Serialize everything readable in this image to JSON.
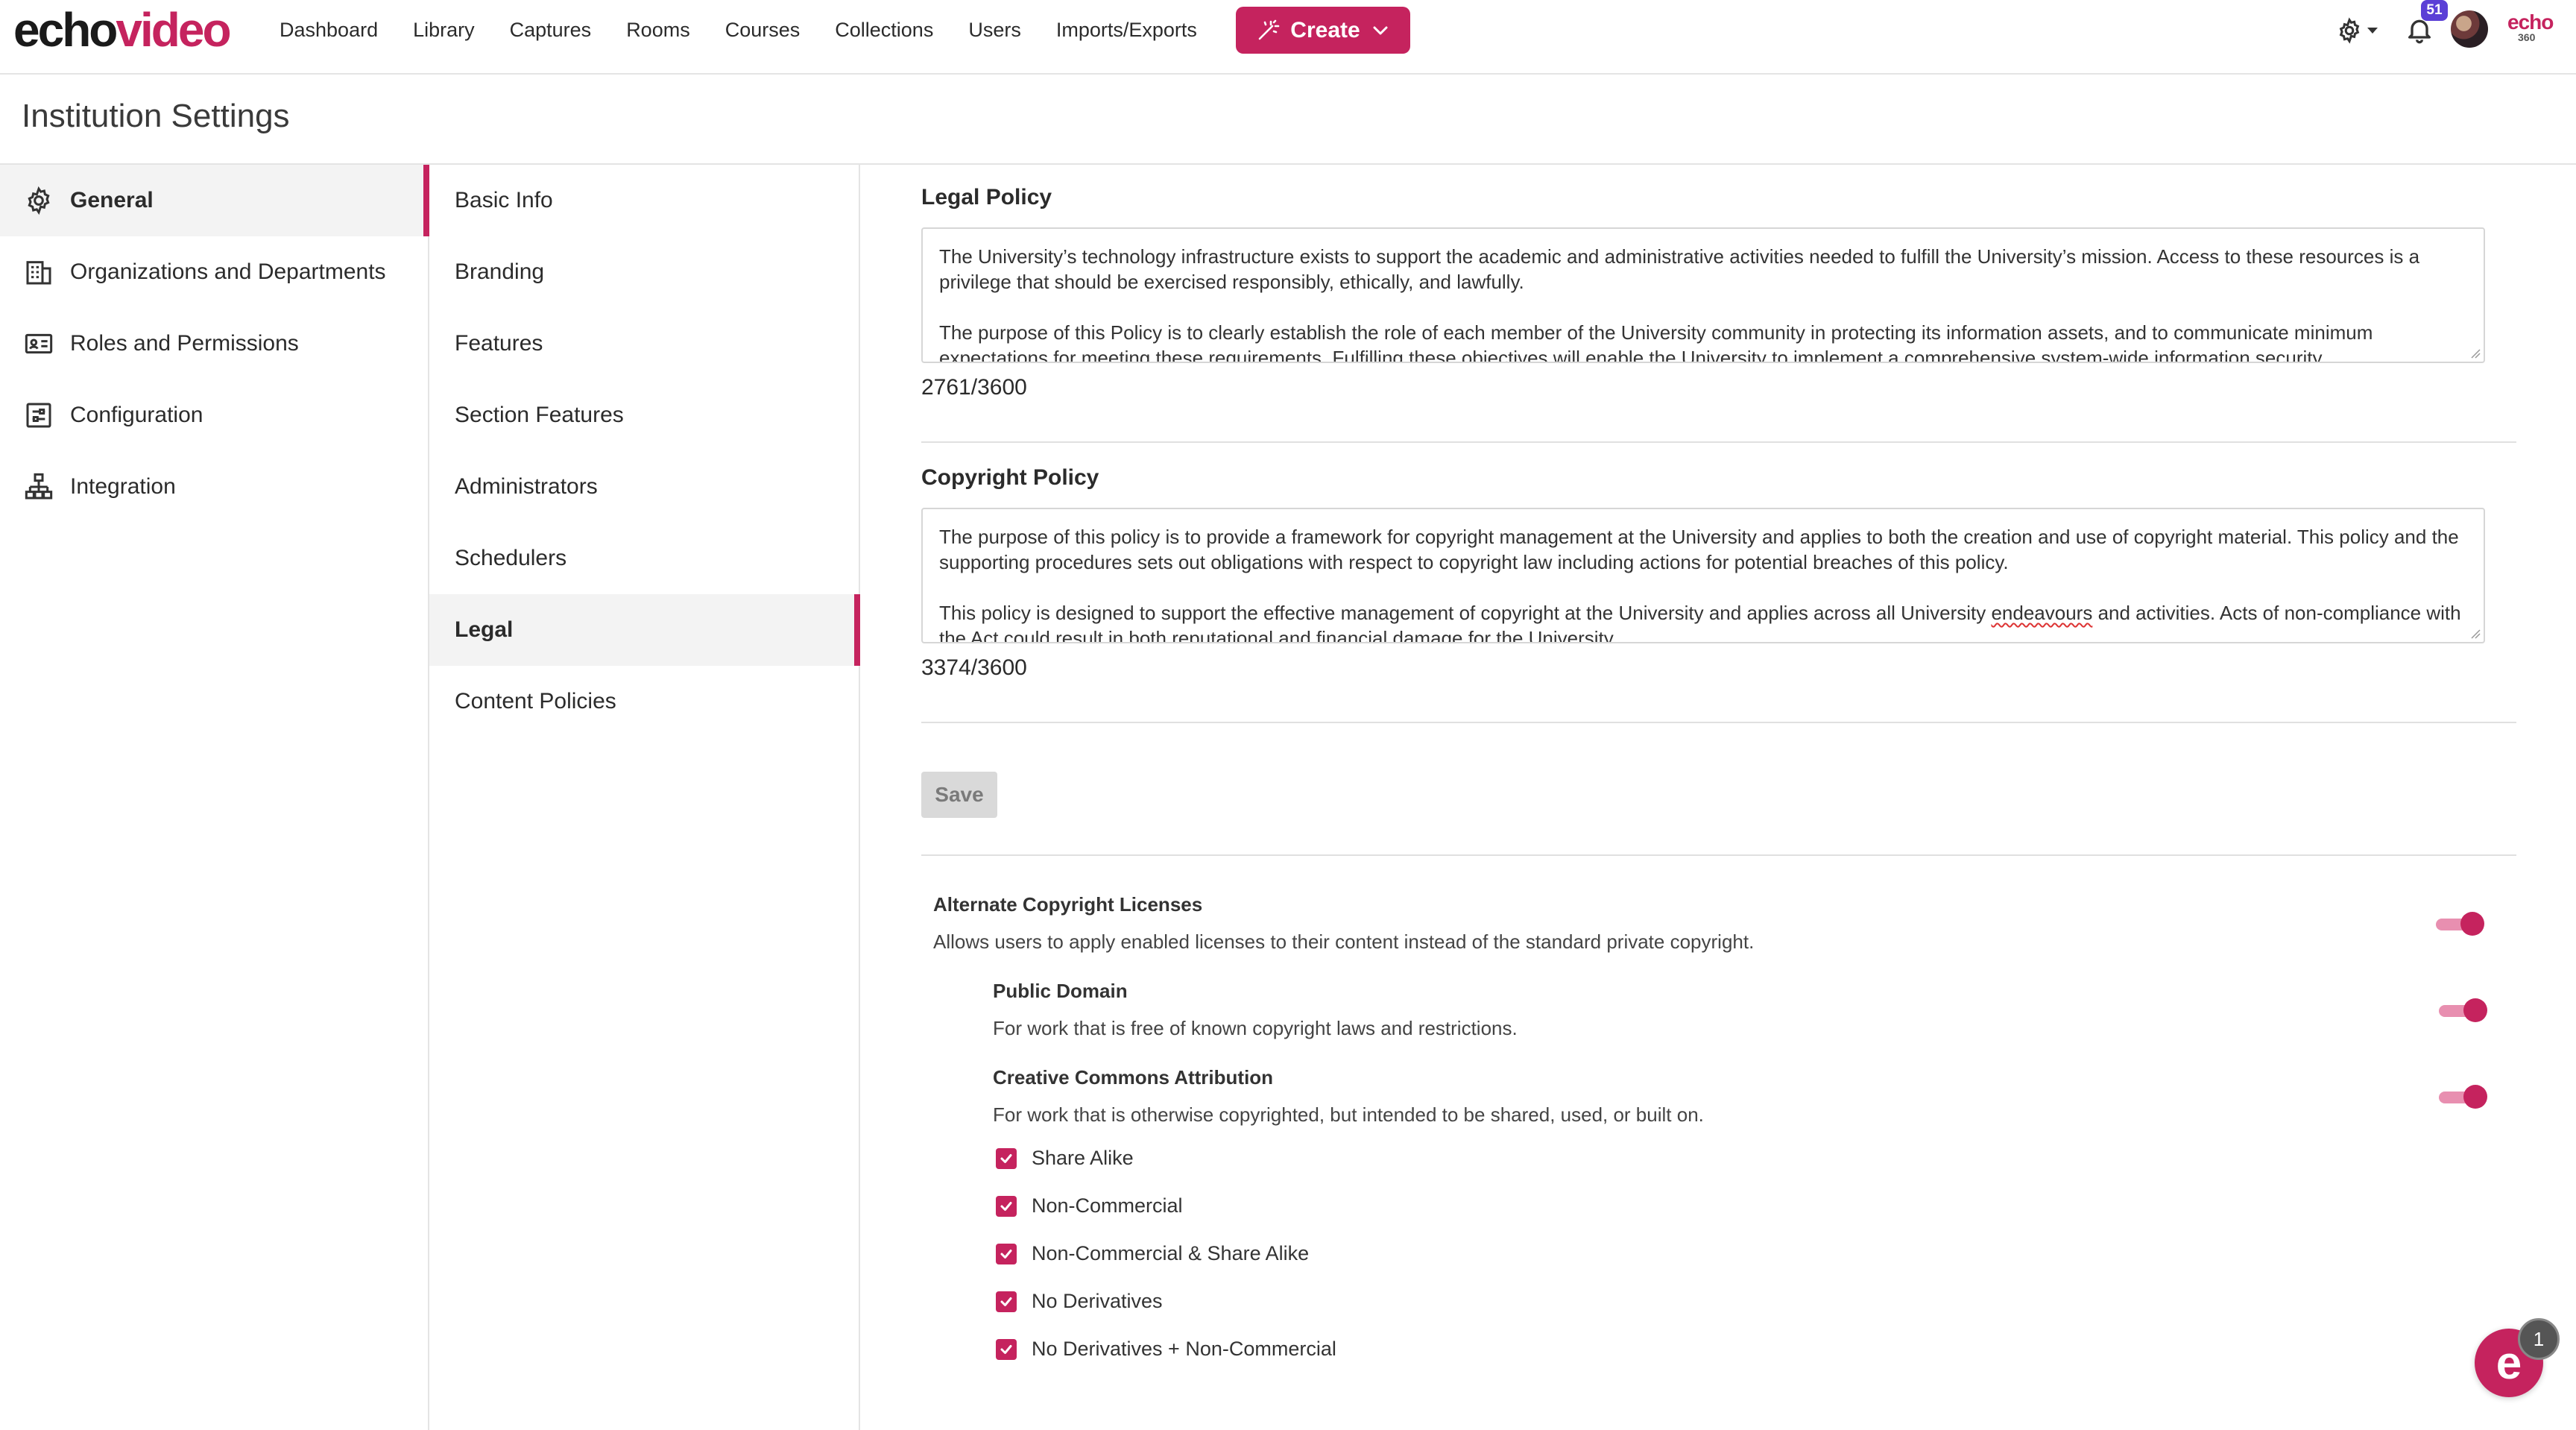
{
  "app": {
    "logo_part1": "echo",
    "logo_part2": "video",
    "nav": [
      "Dashboard",
      "Library",
      "Captures",
      "Rooms",
      "Courses",
      "Collections",
      "Users",
      "Imports/Exports"
    ],
    "create_label": "Create",
    "notification_count": "51",
    "brand_mark_top": "echo",
    "brand_mark_bottom": "360"
  },
  "page_title": "Institution Settings",
  "sidebar": {
    "items": [
      {
        "label": "General",
        "icon": "gear-icon",
        "active": true
      },
      {
        "label": "Organizations and Departments",
        "icon": "building-icon",
        "active": false
      },
      {
        "label": "Roles and Permissions",
        "icon": "id-card-icon",
        "active": false
      },
      {
        "label": "Configuration",
        "icon": "sliders-icon",
        "active": false
      },
      {
        "label": "Integration",
        "icon": "network-icon",
        "active": false
      }
    ]
  },
  "subnav": {
    "items": [
      {
        "label": "Basic Info",
        "active": false
      },
      {
        "label": "Branding",
        "active": false
      },
      {
        "label": "Features",
        "active": false
      },
      {
        "label": "Section Features",
        "active": false
      },
      {
        "label": "Administrators",
        "active": false
      },
      {
        "label": "Schedulers",
        "active": false
      },
      {
        "label": "Legal",
        "active": true
      },
      {
        "label": "Content Policies",
        "active": false
      }
    ]
  },
  "legal": {
    "label": "Legal Policy",
    "para1": "The University’s technology infrastructure exists to support the academic and administrative activities needed to fulfill the University’s mission. Access to these resources is a privilege that should be exercised responsibly, ethically, and lawfully.",
    "para2": "The purpose of this Policy is to clearly establish the role of each member of the University community in protecting its information assets, and to communicate minimum expectations for meeting these requirements. Fulfilling these objectives will enable the University to implement a comprehensive system-wide information security",
    "counter": "2761/3600"
  },
  "copyright": {
    "label": "Copyright Policy",
    "para1": "The purpose of this policy is to provide a framework for copyright management at the University and applies to both the creation and use of copyright material. This policy and the supporting procedures sets out obligations with respect to copyright law including actions for potential breaches of this policy.",
    "para2_a": "This policy is designed to support the effective management of copyright at the University and applies across all University ",
    "para2_b": "endeavours",
    "para2_c": " and activities. Acts of non-compliance with the Act could result in both reputational and financial damage for the University.",
    "counter": "3374/3600"
  },
  "save_label": "Save",
  "licenses": {
    "alt": {
      "title": "Alternate Copyright Licenses",
      "desc": "Allows users to apply enabled licenses to their content instead of the standard private copyright.",
      "enabled": true
    },
    "public_domain": {
      "title": "Public Domain",
      "desc": "For work that is free of known copyright laws and restrictions.",
      "enabled": true
    },
    "cc": {
      "title": "Creative Commons Attribution",
      "desc": "For work that is otherwise copyrighted, but intended to be shared, used, or built on.",
      "enabled": true
    },
    "cc_options": [
      {
        "label": "Share Alike",
        "checked": true
      },
      {
        "label": "Non-Commercial",
        "checked": true
      },
      {
        "label": "Non-Commercial & Share Alike",
        "checked": true
      },
      {
        "label": "No Derivatives",
        "checked": true
      },
      {
        "label": "No Derivatives + Non-Commercial",
        "checked": true
      }
    ]
  },
  "help_badge": "1",
  "colors": {
    "accent": "#c5235e",
    "badge": "#5b3fd6"
  }
}
